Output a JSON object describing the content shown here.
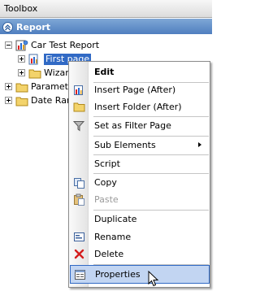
{
  "toolbox": {
    "title": "Toolbox"
  },
  "section": {
    "title": "Report"
  },
  "tree": {
    "root": "Car Test Report",
    "first_page": "First page",
    "wizard": "Wizard",
    "parameters": "Paramete",
    "date_range": "Date Ran"
  },
  "context_menu": {
    "edit": "Edit",
    "insert_page": "Insert Page (After)",
    "insert_folder": "Insert Folder (After)",
    "set_filter": "Set as Filter Page",
    "sub_elements": "Sub Elements",
    "script": "Script",
    "copy": "Copy",
    "paste": "Paste",
    "duplicate": "Duplicate",
    "rename": "Rename",
    "delete": "Delete",
    "properties": "Properties"
  }
}
